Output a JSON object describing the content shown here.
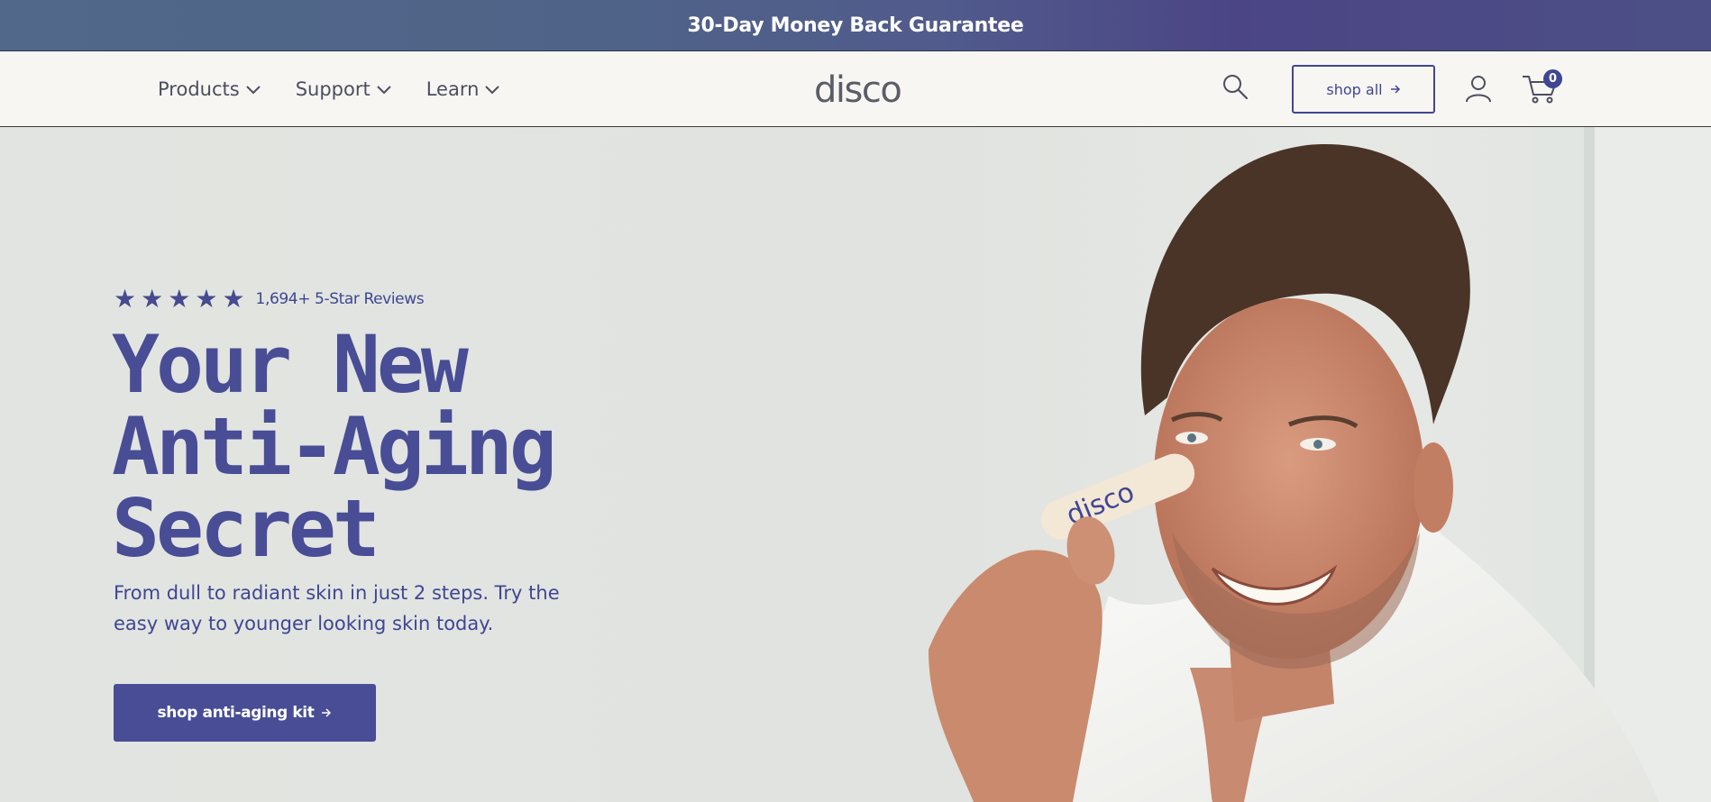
{
  "announcement": {
    "text": "30-Day Money Back Guarantee"
  },
  "header": {
    "nav": [
      {
        "label": "Products"
      },
      {
        "label": "Support"
      },
      {
        "label": "Learn"
      }
    ],
    "logo_text": "disco",
    "shop_all_label": "shop all",
    "cart_count": "0"
  },
  "hero": {
    "rating": {
      "stars": 5,
      "text": "1,694+ 5-Star Reviews"
    },
    "headline": [
      "Your New",
      "Anti-Aging",
      "Secret"
    ],
    "subhead": "From dull to radiant skin in just 2 steps. Try the easy way to younger looking skin today.",
    "cta_label": "shop anti-aging kit",
    "image_alt_stick_text": "disco"
  },
  "colors": {
    "brand": "#484d95",
    "accent_dark": "#3f4693",
    "header_bg": "#f8f6f3",
    "hero_bg": "#e1e3e0"
  },
  "icons": [
    "chevron-down-icon",
    "search-icon",
    "arrow-right-icon",
    "user-icon",
    "cart-icon",
    "star-icon"
  ]
}
